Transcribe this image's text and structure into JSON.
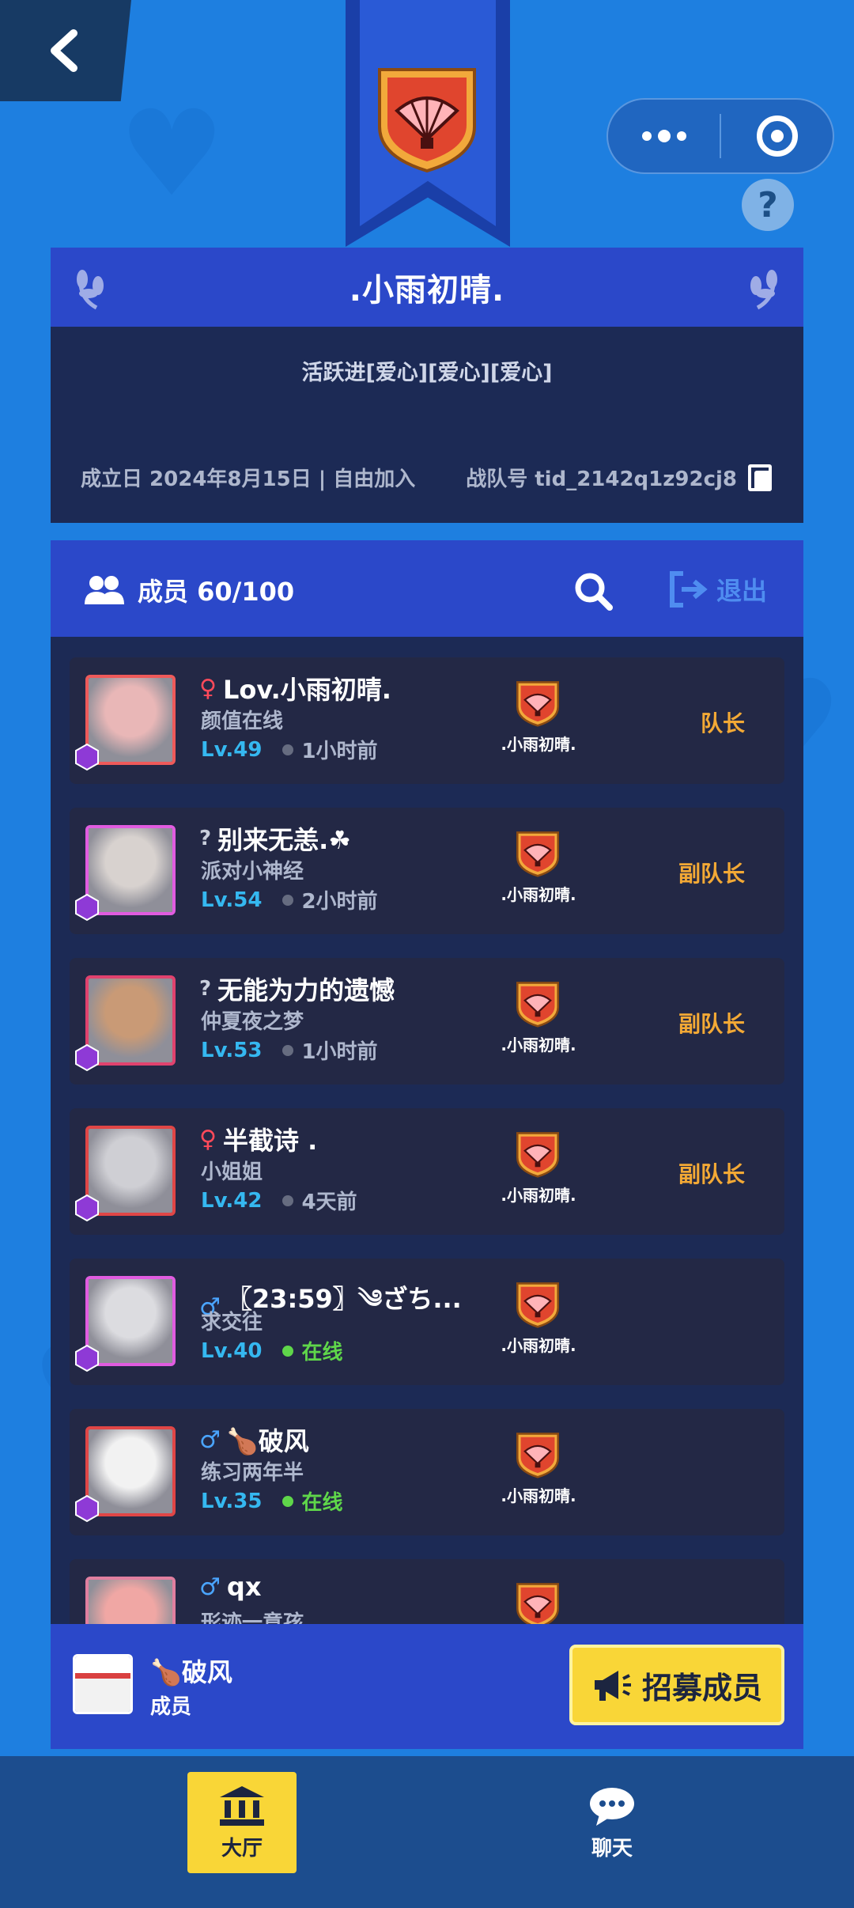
{
  "team": {
    "name": ".小雨初晴.",
    "motto": "活跃进[爱心][爱心][爱心]",
    "founded": "成立日 2024年8月15日 | 自由加入",
    "team_id": "战队号 tid_2142q1z92cj8"
  },
  "members_header": {
    "title": "成员 60/100",
    "exit_label": "退出"
  },
  "members": [
    {
      "gender": "♀",
      "gender_type": "f",
      "name": "Lov.小雨初晴.",
      "title": "颜值在线",
      "level": "Lv.49",
      "status": "1小时前",
      "online": false,
      "team": ".小雨初晴.",
      "role": "队长",
      "avatar_color": "#e9b7b7"
    },
    {
      "gender": "?",
      "gender_type": "u",
      "name": "别来无恙.☘︎",
      "title": "派对小神经",
      "level": "Lv.54",
      "status": "2小时前",
      "online": false,
      "team": ".小雨初晴.",
      "role": "副队长",
      "avatar_color": "#d8d2cf"
    },
    {
      "gender": "?",
      "gender_type": "u",
      "name": "无能为力的遗憾",
      "title": "仲夏夜之梦",
      "level": "Lv.53",
      "status": "1小时前",
      "online": false,
      "team": ".小雨初晴.",
      "role": "副队长",
      "avatar_color": "#c99a76"
    },
    {
      "gender": "♀",
      "gender_type": "f",
      "name": "半截诗 .",
      "title": "小姐姐",
      "level": "Lv.42",
      "status": "4天前",
      "online": false,
      "team": ".小雨初晴.",
      "role": "副队长",
      "avatar_color": "#cfcfd4"
    },
    {
      "gender": "♂",
      "gender_type": "m",
      "name": "〖23:59〗༄ざち...",
      "title": "求交往",
      "level": "Lv.40",
      "status": "在线",
      "online": true,
      "team": ".小雨初晴.",
      "role": "",
      "avatar_color": "#dcdce0"
    },
    {
      "gender": "♂",
      "gender_type": "m",
      "name": "🍗破风",
      "title": "练习两年半",
      "level": "Lv.35",
      "status": "在线",
      "online": true,
      "team": ".小雨初晴.",
      "role": "",
      "avatar_color": "#f2f2f2"
    },
    {
      "gender": "♂",
      "gender_type": "m",
      "name": "qx",
      "title": "形迹一意孩",
      "level": "",
      "status": "",
      "online": false,
      "team": "",
      "role": "",
      "avatar_color": "#f0a7a4"
    }
  ],
  "self": {
    "name": "🍗破风",
    "role": "成员"
  },
  "recruit_label": "招募成员",
  "tabs": [
    {
      "label": "大厅",
      "active": true
    },
    {
      "label": "聊天",
      "active": false
    }
  ],
  "colors": {
    "background": "#1e7fe0",
    "panel_header": "#2b48c9",
    "panel_body": "#1c2a55",
    "row": "#232845",
    "accent_yellow": "#f9d637",
    "role_orange": "#f3a935",
    "level_blue": "#35b8f0",
    "online_green": "#5fd64a"
  }
}
